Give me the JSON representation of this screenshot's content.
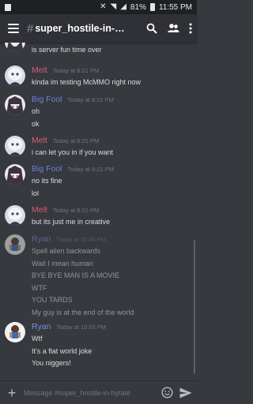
{
  "status_bar": {
    "battery": "81%",
    "time": "11:55 PM"
  },
  "channel": {
    "name": "super_hostile-in-h…"
  },
  "colors": {
    "melt": "#e05777",
    "bigfool": "#6f7fe0",
    "ryan": "#7c8be0"
  },
  "messages": [
    {
      "author": "",
      "time": "",
      "lines": [
        "is server fun time over"
      ]
    },
    {
      "author": "Melt",
      "time": "Today at 8:21 PM",
      "lines": [
        "kinda im testing McMMO right now"
      ]
    },
    {
      "author": "Big Fool",
      "time": "Today at 8:21 PM",
      "lines": [
        "oh",
        "ok"
      ]
    },
    {
      "author": "Melt",
      "time": "Today at 8:21 PM",
      "lines": [
        "i can let you in if you want"
      ]
    },
    {
      "author": "Big Fool",
      "time": "Today at 8:21 PM",
      "lines": [
        "no its fine",
        "lol"
      ]
    },
    {
      "author": "Melt",
      "time": "Today at 8:21 PM",
      "lines": [
        "but its just me in creative"
      ]
    },
    {
      "author": "Ryan",
      "time": "Today at 10:46 PM",
      "lines": [
        "Spell alien backwards",
        "Wait I mean human",
        "BYE BYE MAN IS A MOVIE",
        "WTF",
        "YOU TARDS",
        "My guy is at the end of the world"
      ]
    },
    {
      "author": "Ryan",
      "time": "Today at 10:53 PM",
      "lines": [
        "Wtf",
        "It's a flat world joke",
        "You niggers!"
      ]
    }
  ],
  "composer": {
    "placeholder": "Message #super_hostile-in-hytale"
  }
}
